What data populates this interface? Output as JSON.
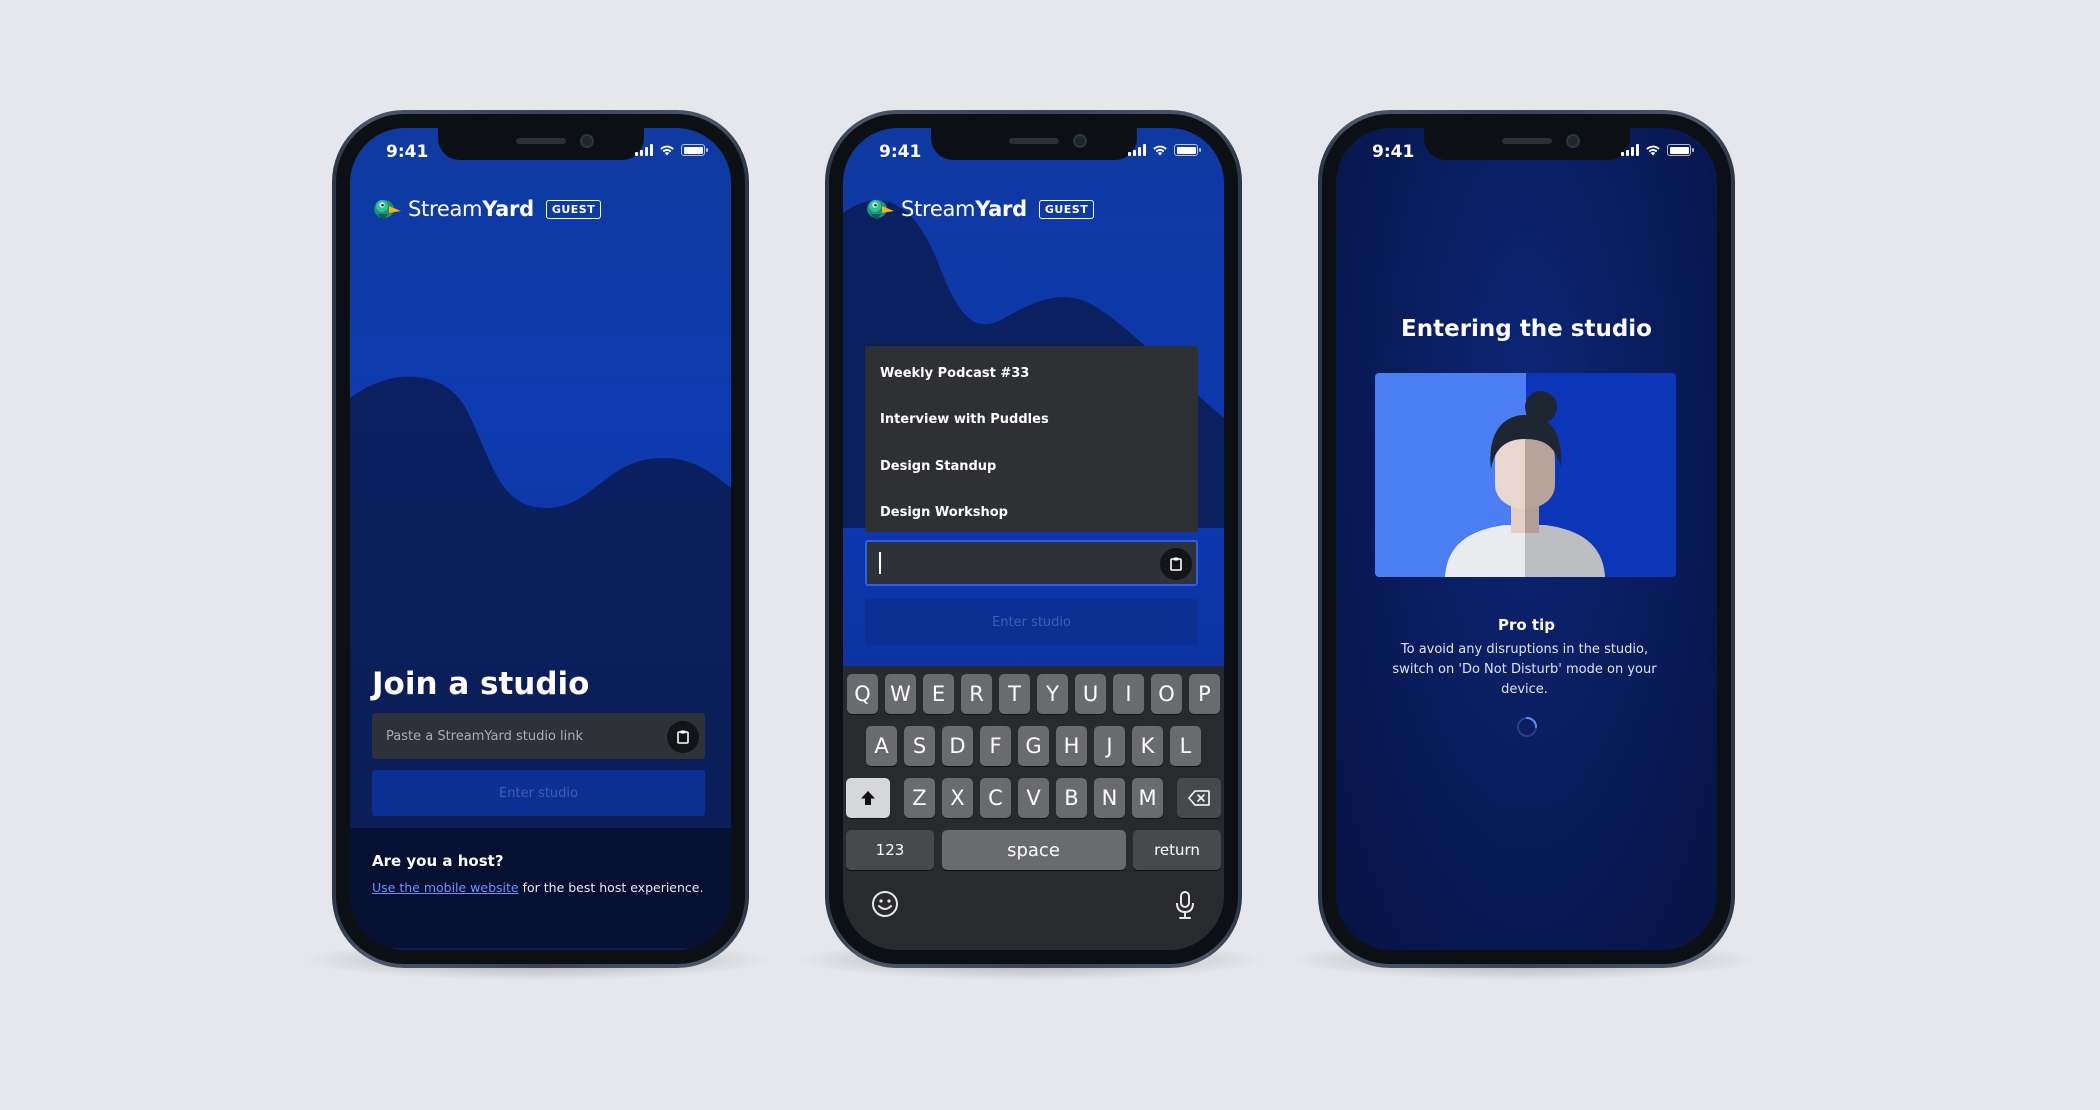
{
  "status": {
    "time": "9:41"
  },
  "brand": {
    "name_light": "Stream",
    "name_bold": "Yard",
    "badge": "GUEST"
  },
  "screen_join": {
    "title": "Join a studio",
    "link_placeholder": "Paste a StreamYard studio link",
    "enter_label": "Enter studio",
    "host_question": "Are you a host?",
    "host_link": "Use the mobile website",
    "host_suffix": " for the best host experience."
  },
  "screen_suggest": {
    "suggestions": [
      "Weekly Podcast #33",
      "Interview with Puddles",
      "Design Standup",
      "Design Workshop"
    ],
    "input_value": "",
    "enter_label": "Enter studio"
  },
  "keyboard": {
    "row1": [
      "Q",
      "W",
      "E",
      "R",
      "T",
      "Y",
      "U",
      "I",
      "O",
      "P"
    ],
    "row2": [
      "A",
      "S",
      "D",
      "F",
      "G",
      "H",
      "J",
      "K",
      "L"
    ],
    "row3": [
      "Z",
      "X",
      "C",
      "V",
      "B",
      "N",
      "M"
    ],
    "numbers_label": "123",
    "space_label": "space",
    "return_label": "return"
  },
  "screen_entering": {
    "title": "Entering the studio",
    "tip_title": "Pro tip",
    "tip_body": "To avoid any disruptions in the studio, switch on 'Do Not Disturb' mode on your device."
  },
  "colors": {
    "page_bg": "#e6e7ec",
    "brand_blue": "#0d3bb1",
    "navy": "#061032",
    "field_dark": "#2e3138",
    "link_blue": "#6d93ff"
  }
}
